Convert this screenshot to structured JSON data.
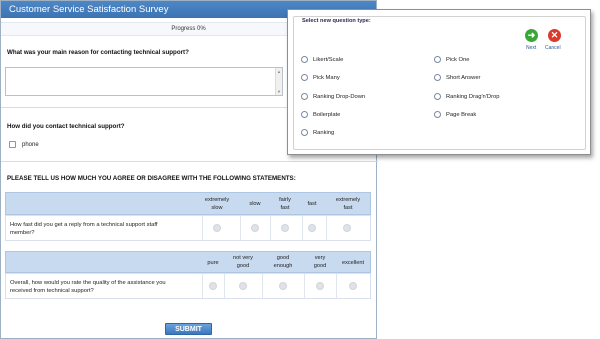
{
  "survey": {
    "title": "Customer Service Satisfaction Survey",
    "progress": "Progress 0%",
    "q1": "What was your main reason for contacting technical support?",
    "q2": "How did you contact technical support?",
    "q2_option": "phone",
    "statement_heading": "PLEASE TELL US HOW MUCH YOU AGREE OR DISAGREE WITH THE FOLLOWING STATEMENTS:",
    "matrix1": {
      "columns": [
        [
          "extremely",
          "slow"
        ],
        [
          "slow"
        ],
        [
          "fairly",
          "fast"
        ],
        [
          "fast"
        ],
        [
          "extremely",
          "fast"
        ]
      ],
      "row": [
        "How fast did you get a reply from a technical support staff",
        "member?"
      ]
    },
    "matrix2": {
      "columns": [
        [
          "pure"
        ],
        [
          "not very",
          "good"
        ],
        [
          "good",
          "enough"
        ],
        [
          "very",
          "good"
        ],
        [
          "excellent"
        ]
      ],
      "row": [
        "Overall, how would you rate the quality of the assistance you",
        "received from technical support?"
      ]
    },
    "submit": "SUBMIT"
  },
  "dialog": {
    "legend": "Select new question type:",
    "next": "Next",
    "cancel": "Cancel",
    "options_left": [
      "Likert/Scale",
      "Pick Many",
      "Ranking Drop-Down",
      "Boilerplate",
      "Ranking"
    ],
    "options_right": [
      "Pick One",
      "Short Answer",
      "Ranking Drag'n'Drop",
      "Page Break"
    ],
    "colors": {
      "next": "#3aa63a",
      "cancel": "#d93a2b"
    }
  }
}
